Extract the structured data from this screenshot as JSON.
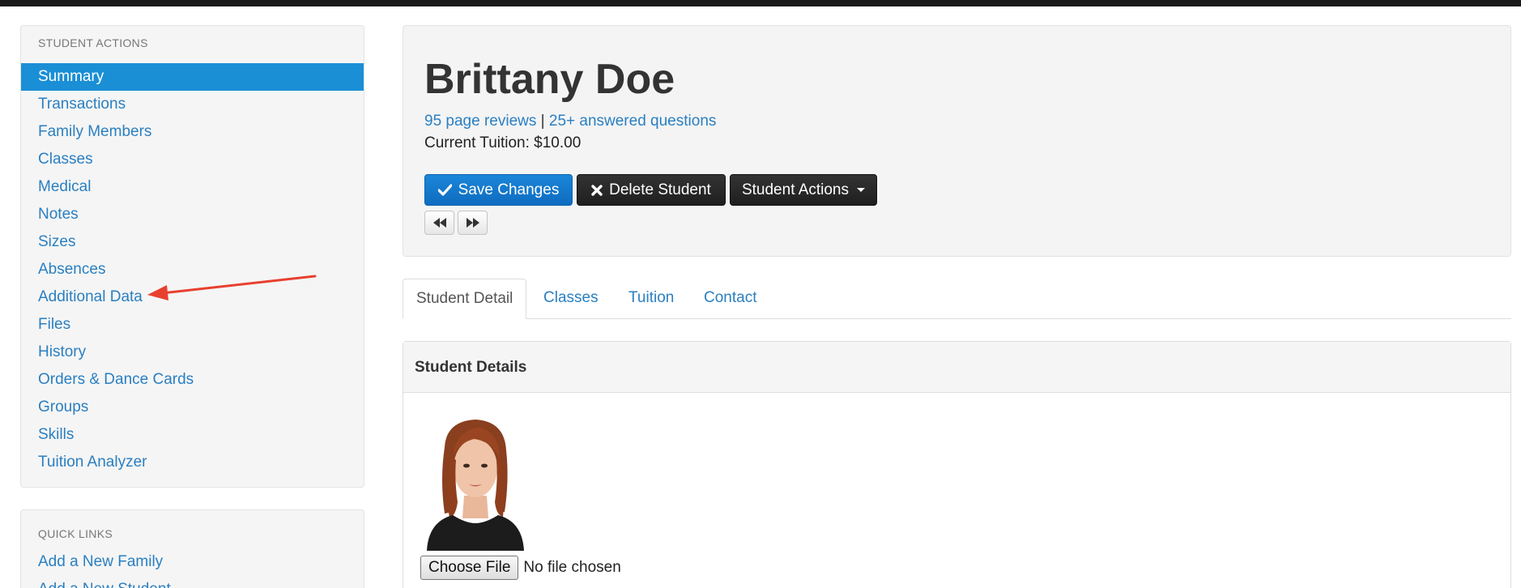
{
  "sidebar": {
    "actions_heading": "STUDENT ACTIONS",
    "items": [
      {
        "label": "Summary",
        "active": true
      },
      {
        "label": "Transactions"
      },
      {
        "label": "Family Members"
      },
      {
        "label": "Classes"
      },
      {
        "label": "Medical"
      },
      {
        "label": "Notes"
      },
      {
        "label": "Sizes"
      },
      {
        "label": "Absences"
      },
      {
        "label": "Additional Data"
      },
      {
        "label": "Files"
      },
      {
        "label": "History"
      },
      {
        "label": "Orders & Dance Cards"
      },
      {
        "label": "Groups"
      },
      {
        "label": "Skills"
      },
      {
        "label": "Tuition Analyzer"
      }
    ],
    "quick_heading": "QUICK LINKS",
    "quick_links": [
      {
        "label": "Add a New Family"
      },
      {
        "label": "Add a New Student"
      }
    ]
  },
  "header": {
    "name": "Brittany Doe",
    "page_reviews": "95 page reviews",
    "separator": " | ",
    "answered": "25+ answered questions",
    "tuition": "Current Tuition: $10.00"
  },
  "buttons": {
    "save": "Save Changes",
    "delete": "Delete Student",
    "actions": "Student Actions"
  },
  "tabs": [
    {
      "label": "Student Detail",
      "active": true
    },
    {
      "label": "Classes"
    },
    {
      "label": "Tuition"
    },
    {
      "label": "Contact"
    }
  ],
  "details": {
    "heading": "Student Details",
    "choose_file": "Choose File",
    "no_file": "No file chosen"
  },
  "colors": {
    "link": "#2a7fc1",
    "active_item": "#1a8fd6",
    "primary_button": "#1378cc",
    "dark_button": "#2a2a2a",
    "annotation_arrow": "#e8402f"
  },
  "icons": {
    "save": "check-icon",
    "delete": "x-icon",
    "prev": "rewind-icon",
    "next": "fast-forward-icon",
    "dropdown": "caret-down-icon"
  }
}
